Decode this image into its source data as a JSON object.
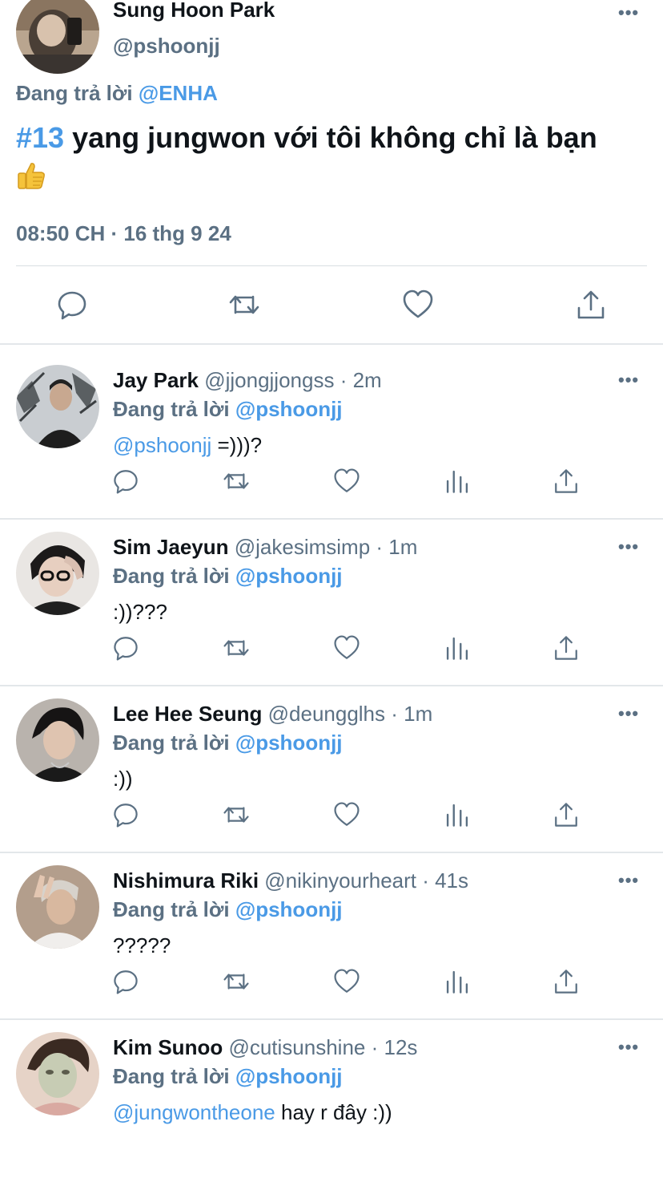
{
  "main_tweet": {
    "name": "Sung Hoon Park",
    "handle": "@pshoonjj",
    "replying_prefix": "Đang trả lời",
    "replying_to": "@ENHA",
    "hashtag": "#13",
    "text": " yang jungwon với tôi không chỉ là bạn",
    "emoji": "thumbs-up",
    "timestamp": "08:50 CH · 16 thg 9 24",
    "actions": [
      "reply-icon",
      "retweet-icon",
      "like-icon",
      "share-icon"
    ]
  },
  "replies": [
    {
      "name": "Jay Park",
      "meta": " @jjongjjongss · 2m",
      "replying_prefix": "Đang trả lời",
      "replying_to": "@pshoonjj",
      "mention": "@pshoonjj",
      "text": " =)))?"
    },
    {
      "name": "Sim Jaeyun",
      "meta": " @jakesimsimp · 1m",
      "replying_prefix": "Đang trả lời",
      "replying_to": "@pshoonjj",
      "mention": "",
      "text": ":))???"
    },
    {
      "name": "Lee Hee Seung",
      "meta": " @deungglhs · 1m",
      "replying_prefix": "Đang trả lời",
      "replying_to": "@pshoonjj",
      "mention": "",
      "text": ":))"
    },
    {
      "name": "Nishimura Riki",
      "meta": " @nikinyourheart · 41s",
      "replying_prefix": "Đang trả lời",
      "replying_to": "@pshoonjj",
      "mention": "",
      "text": "?????"
    },
    {
      "name": "Kim Sunoo",
      "meta": " @cutisunshine · 12s",
      "replying_prefix": "Đang trả lời",
      "replying_to": "@pshoonjj",
      "mention": "@jungwontheone",
      "text": " hay r đây :))"
    }
  ],
  "reply_actions": [
    "reply-icon",
    "retweet-icon",
    "like-icon",
    "analytics-icon",
    "share-icon"
  ],
  "colors": {
    "link": "#4a9ae6",
    "secondary": "#5b7083",
    "icon": "#5b7083",
    "divider": "#e3e7ea"
  }
}
